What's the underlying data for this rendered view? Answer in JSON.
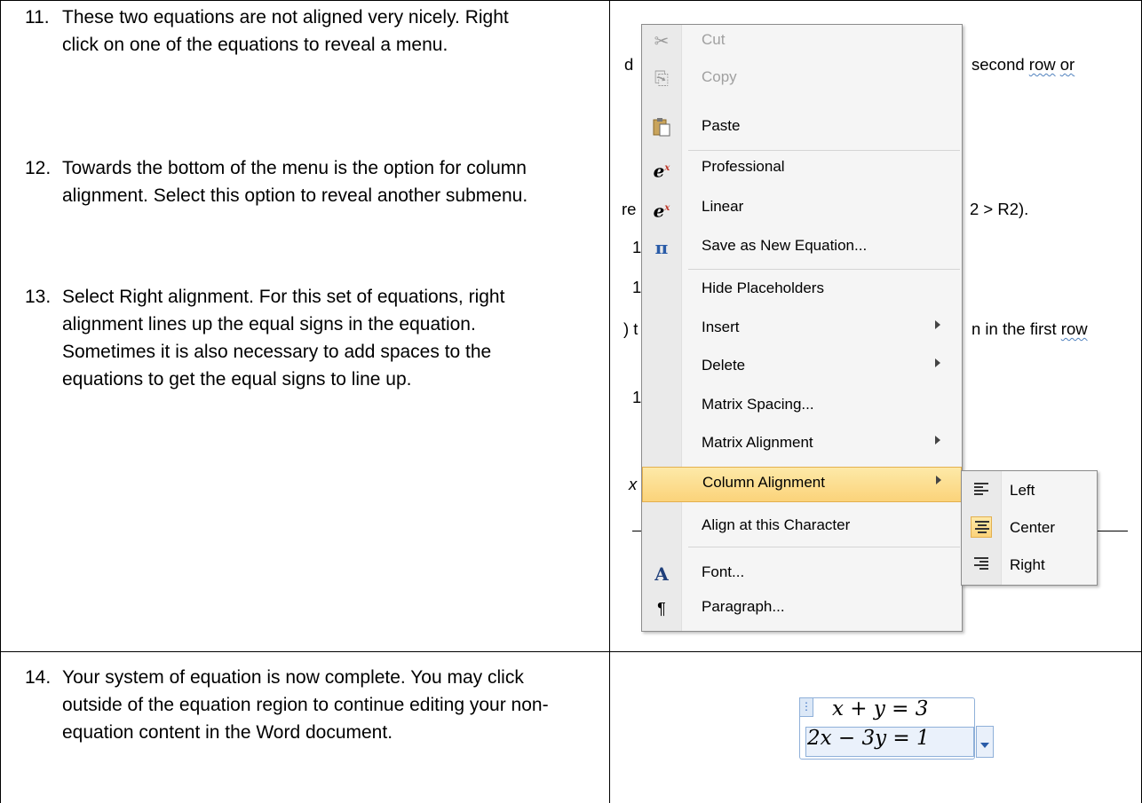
{
  "steps_top": [
    {
      "number": "11.",
      "text": "These two equations are not aligned very nicely. Right click on one of the equations to reveal a menu."
    },
    {
      "number": "12.",
      "text": "Towards the bottom of the menu is the option for column alignment. Select this option to reveal another submenu."
    },
    {
      "number": "13.",
      "text": "Select Right alignment. For this set of equations, right alignment lines up the equal signs in the equation. Sometimes it is also necessary to add spaces to the equations to get the equal signs to line up."
    }
  ],
  "step_bottom": {
    "number": "14.",
    "text": "Your system of equation is now complete. You may click outside of the equation region to continue editing your non-equation content in the Word document."
  },
  "background_doc": {
    "left_fragments": [
      "d",
      "re",
      "1",
      "1",
      ") t",
      "1",
      "x"
    ],
    "right_line1": "second",
    "right_line1_w1": "row",
    "right_line1_w2": "or",
    "right_line2": "2 > R2).",
    "right_line3": "n in the first",
    "right_line3_w": "row"
  },
  "context_menu": {
    "items": [
      {
        "label": "Cut",
        "icon": "scissors-icon",
        "disabled": true
      },
      {
        "label": "Copy",
        "icon": "copy-icon",
        "disabled": true
      },
      {
        "label": "Paste",
        "icon": "paste-icon",
        "disabled": false
      },
      {
        "label": "Professional",
        "icon": "professional-equation-icon",
        "disabled": false
      },
      {
        "label": "Linear",
        "icon": "linear-equation-icon",
        "disabled": false
      },
      {
        "label": "Save as New Equation...",
        "icon": "save-equation-icon",
        "disabled": false
      },
      {
        "label": "Hide Placeholders",
        "icon": "",
        "disabled": false
      },
      {
        "label": "Insert",
        "icon": "",
        "disabled": false,
        "submenu": true
      },
      {
        "label": "Delete",
        "icon": "",
        "disabled": false,
        "submenu": true
      },
      {
        "label": "Matrix Spacing...",
        "icon": "",
        "disabled": false
      },
      {
        "label": "Matrix Alignment",
        "icon": "",
        "disabled": false,
        "submenu": true
      },
      {
        "label": "Column Alignment",
        "icon": "",
        "disabled": false,
        "submenu": true,
        "highlighted": true
      },
      {
        "label": "Align at this Character",
        "icon": "",
        "disabled": false
      },
      {
        "label": "Font...",
        "icon": "font-icon",
        "disabled": false
      },
      {
        "label": "Paragraph...",
        "icon": "paragraph-icon",
        "disabled": false
      }
    ]
  },
  "column_alignment_submenu": {
    "items": [
      {
        "label": "Left",
        "icon": "align-left-icon",
        "checked": false
      },
      {
        "label": "Center",
        "icon": "align-center-icon",
        "checked": true
      },
      {
        "label": "Right",
        "icon": "align-right-icon",
        "checked": false
      }
    ]
  },
  "equation": {
    "line1": "x + y = 3",
    "line2": "2x − 3y = 1"
  }
}
